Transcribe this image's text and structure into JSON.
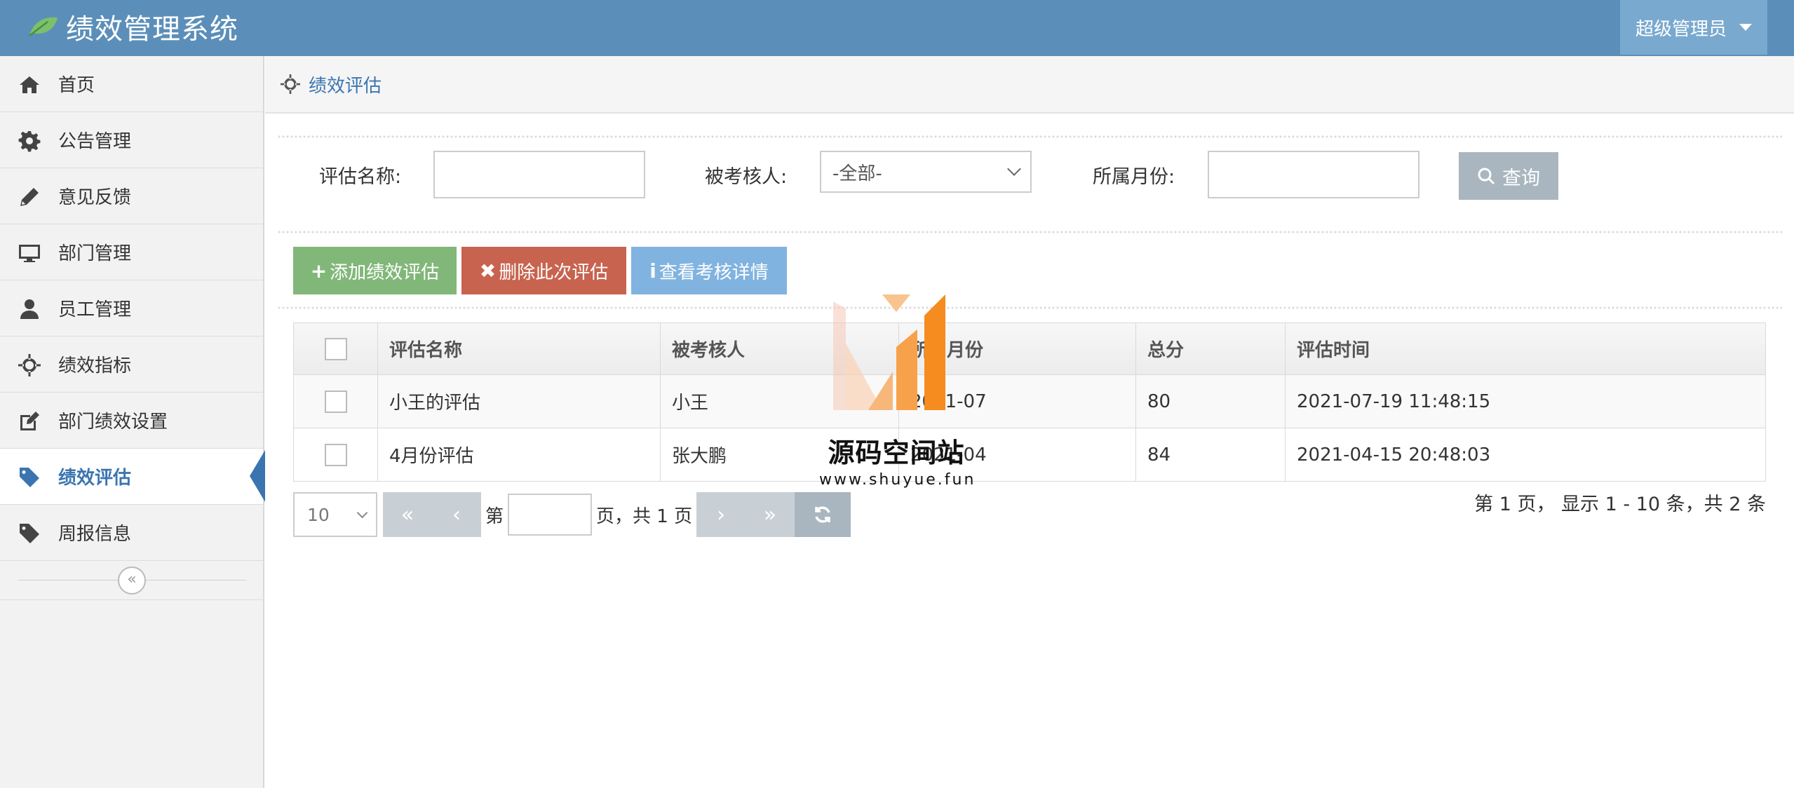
{
  "app": {
    "title": "绩效管理系统",
    "user": "超级管理员"
  },
  "sidebar": {
    "items": [
      {
        "label": "首页",
        "icon": "home-icon"
      },
      {
        "label": "公告管理",
        "icon": "gear-icon"
      },
      {
        "label": "意见反馈",
        "icon": "pencil-icon"
      },
      {
        "label": "部门管理",
        "icon": "monitor-icon"
      },
      {
        "label": "员工管理",
        "icon": "user-icon"
      },
      {
        "label": "绩效指标",
        "icon": "crosshair-icon"
      },
      {
        "label": "部门绩效设置",
        "icon": "edit-icon"
      },
      {
        "label": "绩效评估",
        "icon": "tag-icon",
        "active": true
      },
      {
        "label": "周报信息",
        "icon": "tag-icon"
      }
    ],
    "collapse_glyph": "«"
  },
  "breadcrumb": {
    "label": "绩效评估"
  },
  "search": {
    "name_label": "评估名称:",
    "name_value": "",
    "person_label": "被考核人:",
    "person_selected": "-全部-",
    "month_label": "所属月份:",
    "month_value": "",
    "query_label": "查询"
  },
  "toolbar": {
    "add_label": "添加绩效评估",
    "delete_label": "删除此次评估",
    "detail_label": "查看考核详情"
  },
  "table": {
    "headers": [
      "评估名称",
      "被考核人",
      "所属月份",
      "总分",
      "评估时间"
    ],
    "rows": [
      {
        "name": "小王的评估",
        "person": "小王",
        "month": "2021-07",
        "score": "80",
        "time": "2021-07-19 11:48:15"
      },
      {
        "name": "4月份评估",
        "person": "张大鹏",
        "month": "2021-04",
        "score": "84",
        "time": "2021-04-15 20:48:03"
      }
    ]
  },
  "pager": {
    "page_size": "10",
    "prefix": "第",
    "suffix": "页，共 1 页",
    "page_value": "",
    "first": "«",
    "prev": "‹",
    "next": "›",
    "last": "»",
    "info": "第 1 页， 显示 1 - 10 条，共 2 条"
  },
  "watermark": {
    "title": "源码空间站",
    "url": "www.shuyue.fun"
  },
  "colors": {
    "header": "#5b8fb9",
    "accent": "#3a75b0",
    "add": "#82b77a",
    "delete": "#c8634f",
    "detail": "#81b3e0",
    "watermark": "#f68b1f"
  }
}
